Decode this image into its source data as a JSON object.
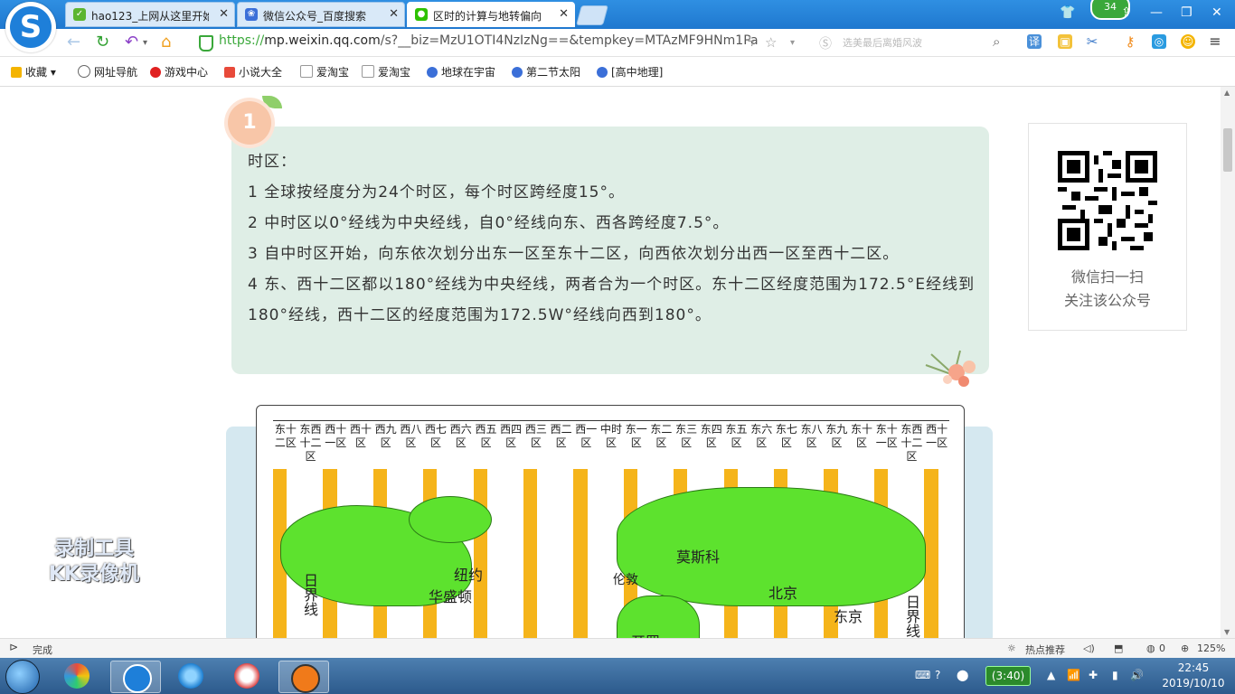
{
  "tabs": [
    {
      "label": "hao123_上网从这里开始",
      "icon": "hao123-icon",
      "active": false
    },
    {
      "label": "微信公众号_百度搜索",
      "icon": "baidu-paw-icon",
      "active": false
    },
    {
      "label": "区时的计算与地转偏向",
      "icon": "wechat-icon",
      "active": true
    }
  ],
  "badge_count": "34",
  "address": {
    "scheme": "https://",
    "host": "mp.weixin.qq.com",
    "path": "/s?__biz=MzU1OTI4NzIzNg==&tempkey=MTAzMF9HNm1Pa"
  },
  "search": {
    "placeholder": "选美最后离婚风波"
  },
  "bookmarks": [
    {
      "label": "收藏",
      "icon": "star-icon"
    },
    {
      "label": "网址导航",
      "icon": "globe-icon"
    },
    {
      "label": "游戏中心",
      "icon": "game-icon"
    },
    {
      "label": "小说大全",
      "icon": "book-icon"
    },
    {
      "label": "爱淘宝",
      "icon": "page-icon"
    },
    {
      "label": "爱淘宝",
      "icon": "page-icon"
    },
    {
      "label": "地球在宇宙",
      "icon": "baidu-paw-icon"
    },
    {
      "label": "第二节太阳",
      "icon": "baidu-paw-icon"
    },
    {
      "label": "[高中地理]",
      "icon": "baidu-paw-icon"
    }
  ],
  "article": {
    "section_number": "1",
    "notes": [
      "时区：",
      "1 全球按经度分为24个时区，每个时区跨经度15°。",
      "2 中时区以0°经线为中央经线，自0°经线向东、西各跨经度7.5°。",
      "3 自中时区开始，向东依次划分出东一区至东十二区，向西依次划分出西一区至西十二区。",
      "4 东、西十二区都以180°经线为中央经线，两者合为一个时区。东十二区经度范围为172.5°E经线到180°经线，西十二区的经度范围为172.5W°经线向西到180°。"
    ]
  },
  "qr": {
    "caption1": "微信扫一扫",
    "caption2": "关注该公众号"
  },
  "map": {
    "zones": [
      "东十二区",
      "东西十二区",
      "西十一区",
      "西十区",
      "西九区",
      "西八区",
      "西七区",
      "西六区",
      "西五区",
      "西四区",
      "西三区",
      "西二区",
      "西一区",
      "中时区",
      "东一区",
      "东二区",
      "东三区",
      "东四区",
      "东五区",
      "东六区",
      "东七区",
      "东八区",
      "东九区",
      "东十区",
      "东十一区",
      "东西十二区",
      "西十一区"
    ],
    "cities": [
      "纽约",
      "华盛顿",
      "伦敦",
      "莫斯科",
      "北京",
      "东京",
      "开罗"
    ],
    "line_labels": [
      "日界线",
      "日界线"
    ]
  },
  "watermark": [
    "录制工具",
    "KK录像机"
  ],
  "status": {
    "text": "完成",
    "hot": "热点推荐",
    "count": "0",
    "zoom": "125%"
  },
  "taskbar": {
    "time": "22:45",
    "date": "2019/10/10",
    "battery": "(3:40)"
  }
}
